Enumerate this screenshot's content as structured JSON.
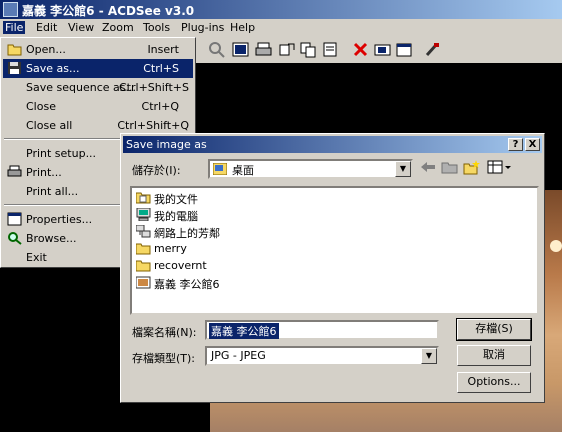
{
  "app": {
    "title": "嘉義 李公館6 - ACDSee v3.0"
  },
  "menubar": [
    "File",
    "Edit",
    "View",
    "Zoom",
    "Tools",
    "Plug-ins",
    "Help"
  ],
  "file_menu": {
    "items": [
      {
        "label": "Open...",
        "shortcut": "Insert",
        "icon": "open-folder-icon"
      },
      {
        "label": "Save as...",
        "shortcut": "Ctrl+S",
        "icon": "floppy-disk-icon",
        "selected": true
      },
      {
        "label": "Save sequence as...",
        "shortcut": "Ctrl+Shift+S"
      },
      {
        "label": "Close",
        "shortcut": "Ctrl+Q"
      },
      {
        "label": "Close all",
        "shortcut": "Ctrl+Shift+Q"
      },
      {
        "label": "Print setup...",
        "shortcut": ""
      },
      {
        "label": "Print...",
        "shortcut": "",
        "icon": "printer-icon"
      },
      {
        "label": "Print all...",
        "shortcut": "C"
      },
      {
        "label": "Properties...",
        "shortcut": "",
        "icon": "properties-icon"
      },
      {
        "label": "Browse...",
        "shortcut": "",
        "icon": "browse-icon"
      },
      {
        "label": "Exit",
        "shortcut": ""
      }
    ]
  },
  "dialog": {
    "title": "Save image as",
    "help_button": "?",
    "close_button": "X",
    "save_in_label": "儲存於(I):",
    "save_in_value": "桌面",
    "files": [
      {
        "name": "我的文件",
        "icon": "documents-folder-icon"
      },
      {
        "name": "我的電腦",
        "icon": "computer-icon"
      },
      {
        "name": "網路上的芳鄰",
        "icon": "network-icon"
      },
      {
        "name": "merry",
        "icon": "folder-icon"
      },
      {
        "name": "recovernt",
        "icon": "folder-icon"
      },
      {
        "name": "嘉義 李公館6",
        "icon": "jpeg-file-icon"
      }
    ],
    "filename_label": "檔案名稱(N):",
    "filename_value": "嘉義 李公館6",
    "filetype_label": "存檔類型(T):",
    "filetype_value": "JPG - JPEG",
    "save_button": "存檔(S)",
    "cancel_button": "取消",
    "options_button": "Options..."
  },
  "colors": {
    "title_blue": "#0a246a",
    "face": "#d4d0c8",
    "folder_yellow": "#f6d864"
  }
}
